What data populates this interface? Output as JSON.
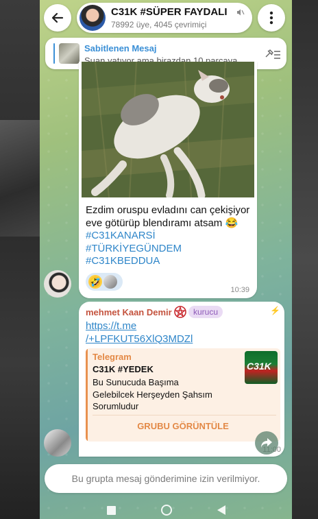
{
  "header": {
    "title": "C31K #SÜPER FAYDALI",
    "subtitle": "78992 üye, 4045 çevrimiçi"
  },
  "pinned": {
    "label": "Sabitlenen Mesaj",
    "text": "Şuan yatıyor ama birazdan 10 parçaya..."
  },
  "messages": [
    {
      "text_plain": "Ezdim oruspu evladını can çekişiyor eve götürüp blendıramı atsam",
      "emoji": "😂",
      "hashtags": [
        "#C31KANARSİ",
        "#TÜRKİYEGÜNDEM",
        "#C31KBEDDUA"
      ],
      "reactions": [
        "🤣",
        "avatar"
      ],
      "time": "10:39"
    },
    {
      "sender": "mehmet Kaan Demir",
      "role": "kurucu",
      "link": "https://t.me/+LPFKUT56XlQ3MDZl",
      "link_line1": "https://t.me",
      "link_line2": "/+LPFKUT56XlQ3MDZl",
      "preview": {
        "site": "Telegram",
        "title": "C31K #YEDEK",
        "description": "Bu Sunucuda Başıma Gelebilcek Herşeyden Şahsım Sorumludur",
        "thumb_text": "C31K",
        "action": "GRUBU GÖRÜNTÜLE"
      },
      "time": "11:00"
    }
  ],
  "input": {
    "restricted_text": "Bu grupta mesaj gönderimine izin verilmiyor."
  },
  "colors": {
    "link": "#2f86c9",
    "sender": "#c4533e",
    "preview_accent": "#e38946",
    "badge": "#8e5bb8"
  }
}
